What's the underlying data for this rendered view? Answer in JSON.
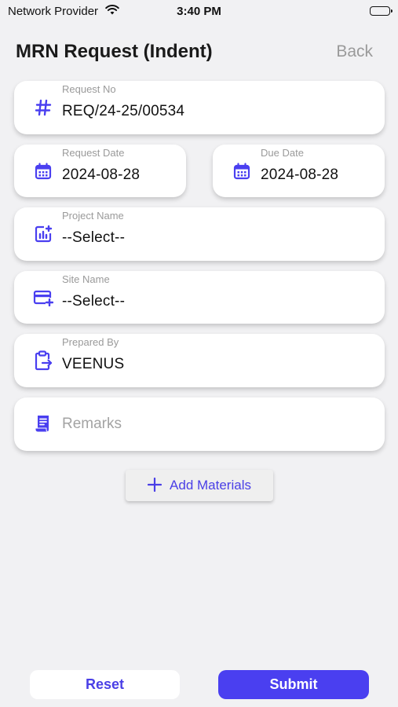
{
  "status_bar": {
    "carrier": "Network Provider",
    "time": "3:40 PM"
  },
  "header": {
    "title": "MRN Request (Indent)",
    "back_label": "Back"
  },
  "form": {
    "request_no": {
      "label": "Request No",
      "value": "REQ/24-25/00534",
      "icon": "hash-icon"
    },
    "request_date": {
      "label": "Request Date",
      "value": "2024-08-28",
      "icon": "calendar-icon"
    },
    "due_date": {
      "label": "Due Date",
      "value": "2024-08-28",
      "icon": "calendar-icon"
    },
    "project_name": {
      "label": "Project Name",
      "value": "--Select--",
      "icon": "chart-plus-icon"
    },
    "site_name": {
      "label": "Site Name",
      "value": "--Select--",
      "icon": "card-plus-icon"
    },
    "prepared_by": {
      "label": "Prepared By",
      "value": "VEENUS",
      "icon": "clipboard-arrow-icon"
    },
    "remarks": {
      "placeholder": "Remarks",
      "icon": "receipt-icon"
    }
  },
  "actions": {
    "add_materials_label": "Add Materials",
    "reset_label": "Reset",
    "submit_label": "Submit"
  },
  "colors": {
    "accent": "#4a3ff0",
    "background": "#f1f1f3",
    "card": "#ffffff",
    "muted_text": "#9a9a9a"
  }
}
